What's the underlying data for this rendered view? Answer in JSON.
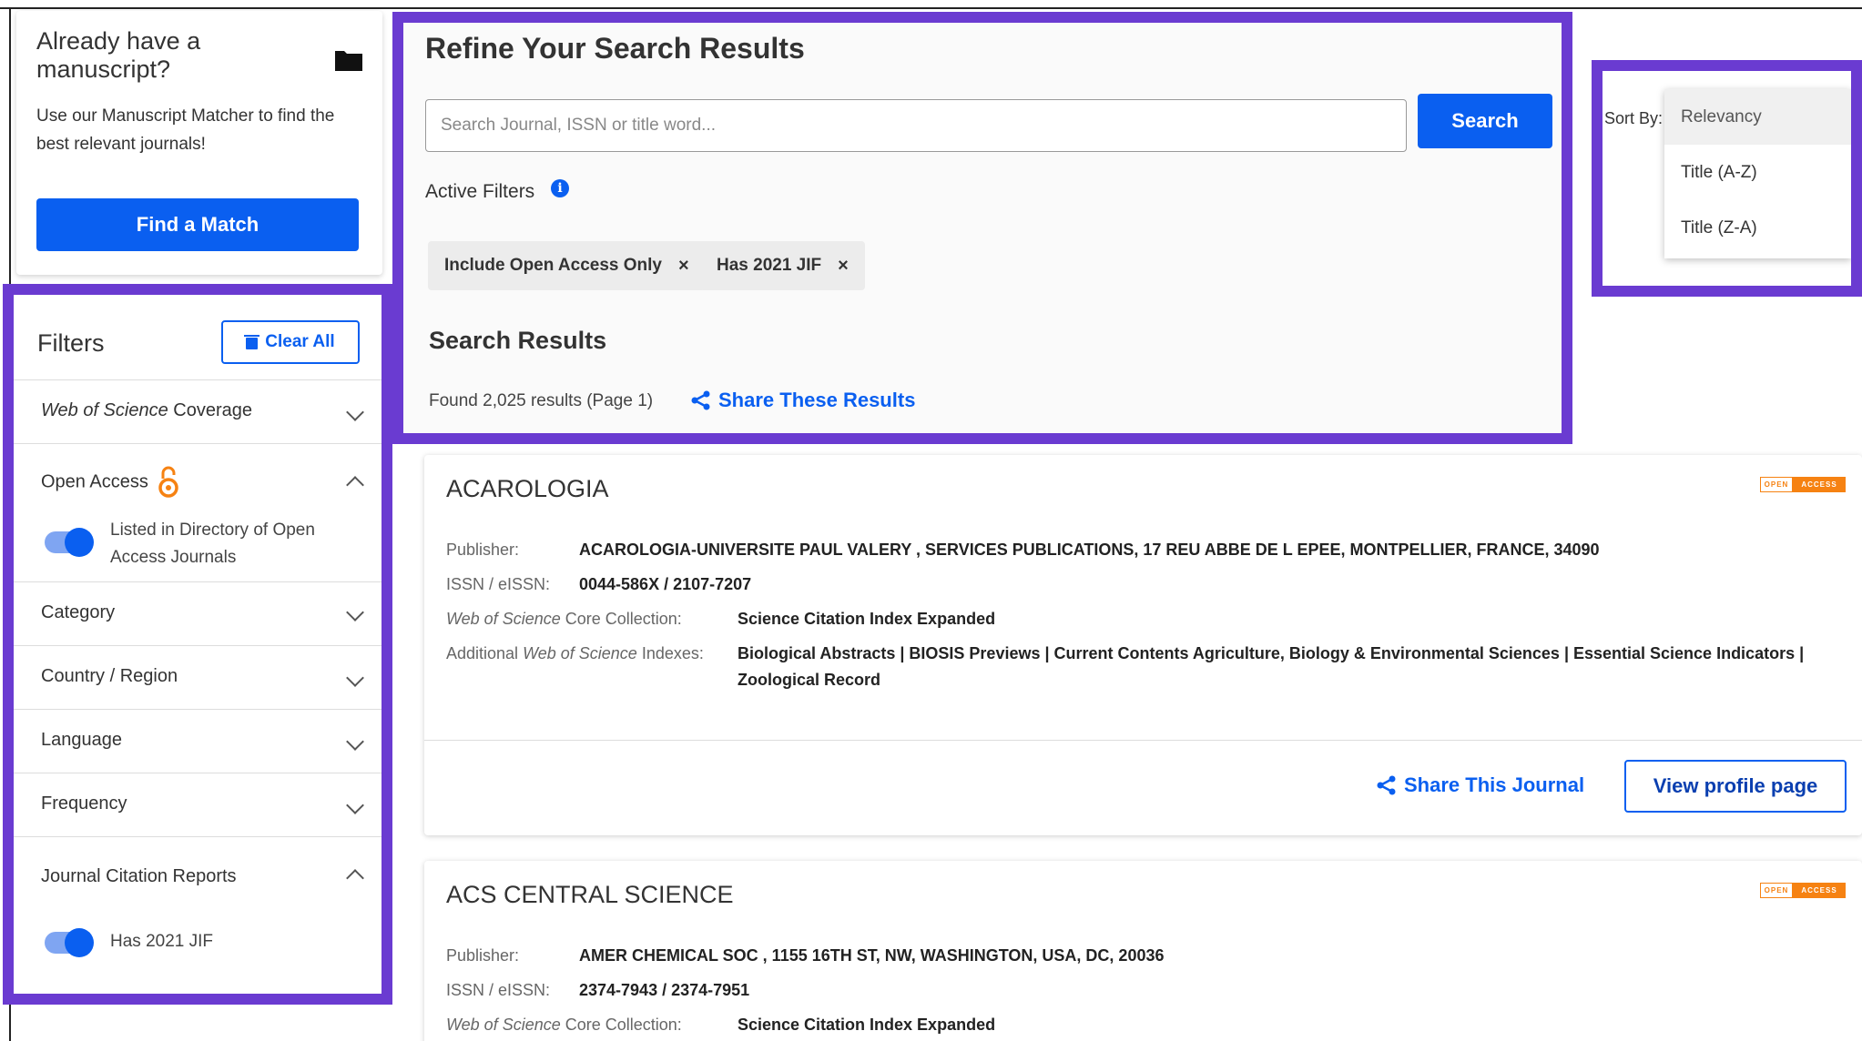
{
  "manuscript": {
    "title": "Already have a manuscript?",
    "description": "Use our Manuscript Matcher to find the best relevant journals!",
    "button": "Find a Match"
  },
  "filters": {
    "title": "Filters",
    "clear_all": "Clear All",
    "sections": {
      "wos_coverage_italic": "Web of Science",
      "wos_coverage_rest": " Coverage",
      "open_access": "Open Access",
      "open_access_toggle": "Listed in Directory of Open Access Journals",
      "category": "Category",
      "country": "Country / Region",
      "language": "Language",
      "frequency": "Frequency",
      "jcr": "Journal Citation Reports",
      "jcr_toggle": "Has 2021 JIF"
    }
  },
  "refine": {
    "title": "Refine Your Search Results",
    "search_placeholder": "Search Journal, ISSN or title word...",
    "search_button": "Search",
    "active_filters_label": "Active Filters",
    "chips": [
      "Include Open Access Only",
      "Has 2021 JIF"
    ],
    "results_title": "Search Results",
    "found_text": "Found 2,025 results (Page 1)",
    "share_results": "Share These Results"
  },
  "sort": {
    "label": "Sort By:",
    "options": [
      "Relevancy",
      "Title (A-Z)",
      "Title (Z-A)"
    ],
    "selected": "Relevancy"
  },
  "labels": {
    "publisher": "Publisher:",
    "issn": "ISSN / eISSN:",
    "wos_italic": "Web of Science",
    "core_rest": " Core Collection:",
    "additional_prefix": "Additional ",
    "indexes_rest": " Indexes:",
    "oa_badge_left": "OPEN",
    "oa_badge_right": "ACCESS",
    "share_journal": "Share This Journal",
    "view_profile": "View profile page"
  },
  "results": [
    {
      "title": "ACAROLOGIA",
      "publisher": "ACAROLOGIA-UNIVERSITE PAUL VALERY , SERVICES PUBLICATIONS, 17 REU ABBE DE L EPEE, MONTPELLIER, FRANCE, 34090",
      "issn": "0044-586X / 2107-7207",
      "core": "Science Citation Index Expanded",
      "indexes_line1": "Biological Abstracts | BIOSIS Previews | Current Contents Agriculture, Biology & Environmental Sciences | Essential Science Indicators |",
      "indexes_line2": "Zoological Record"
    },
    {
      "title": "ACS CENTRAL SCIENCE",
      "publisher": "AMER CHEMICAL SOC , 1155 16TH ST, NW, WASHINGTON, USA, DC, 20036",
      "issn": "2374-7943 / 2374-7951",
      "core": "Science Citation Index Expanded"
    }
  ],
  "colors": {
    "accent": "#0a5ff0",
    "highlight": "#6a3bd1",
    "open_access": "#f68212"
  }
}
